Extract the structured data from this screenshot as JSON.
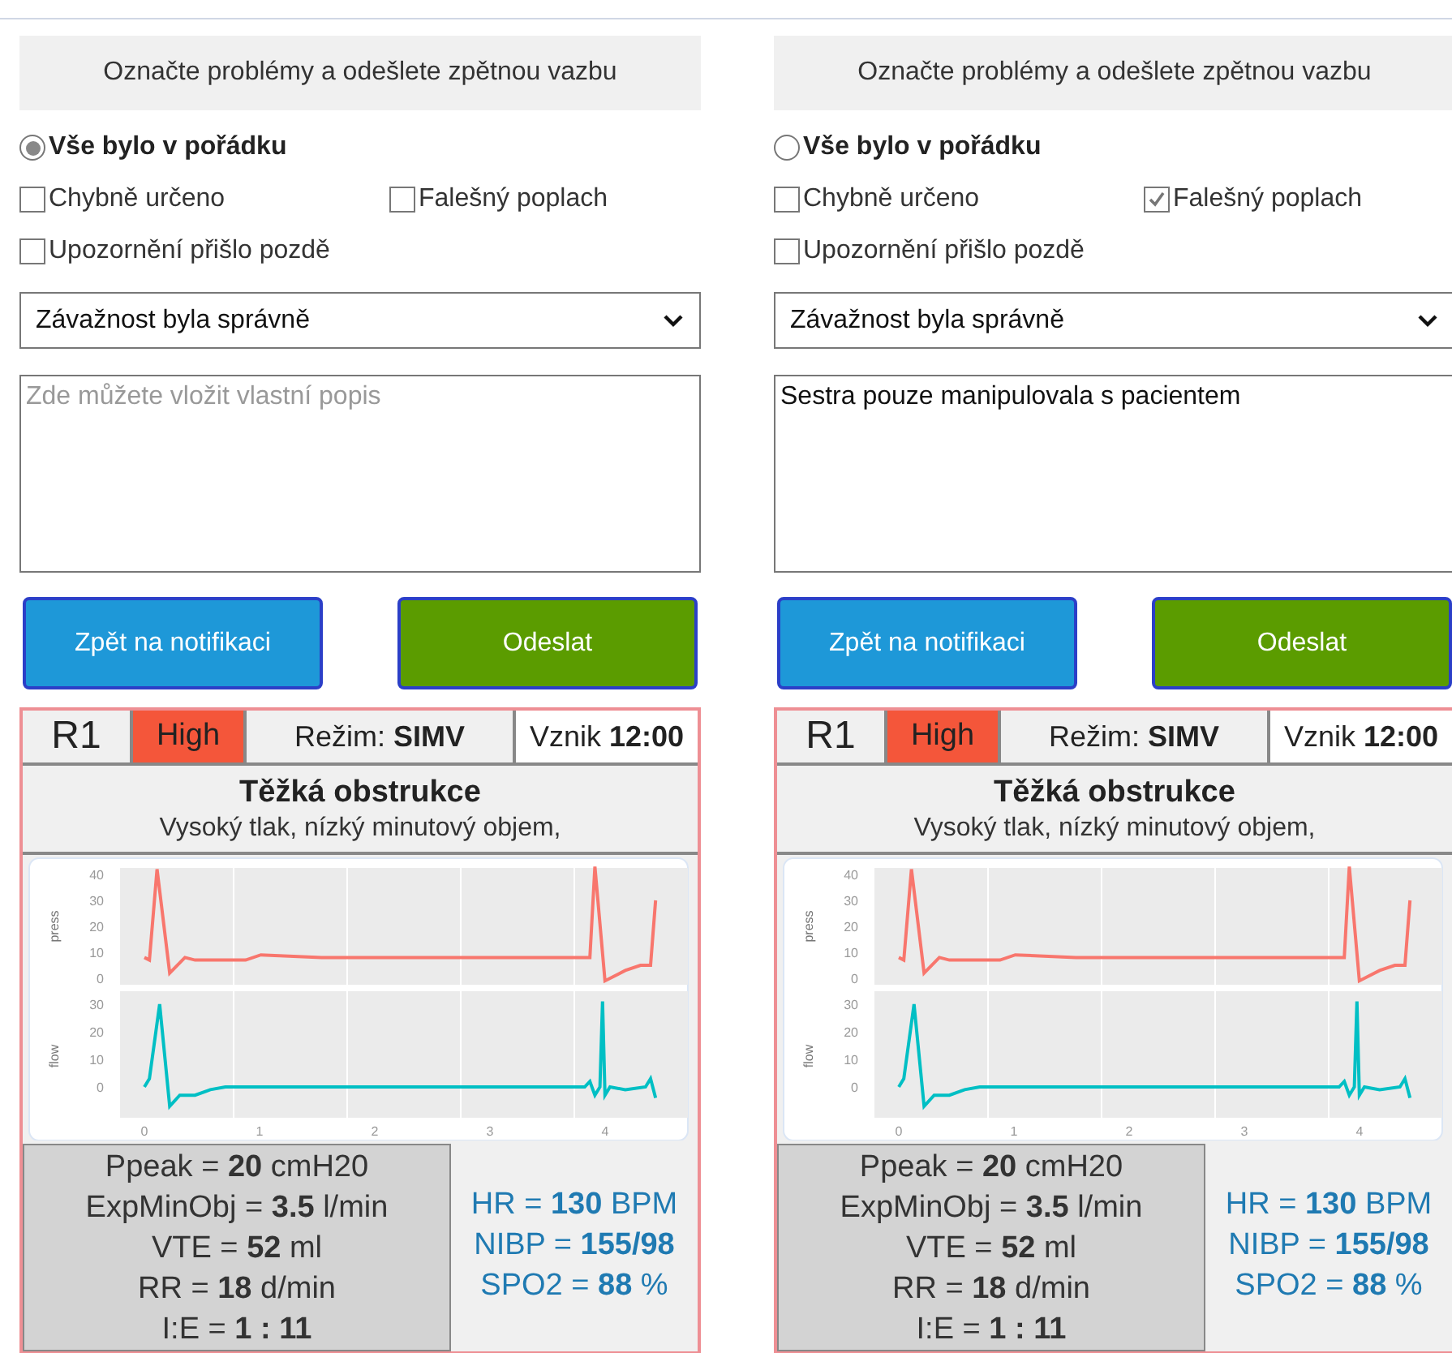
{
  "panels": [
    {
      "header": "Označte problémy a odešlete zpětnou vazbu",
      "radio": {
        "label": "Vše bylo v pořádku",
        "selected": true
      },
      "checkboxes": [
        {
          "label": "Chybně určeno",
          "checked": false
        },
        {
          "label": "Falešný poplach",
          "checked": false
        },
        {
          "label": "Upozornění přišlo pozdě",
          "checked": false
        }
      ],
      "select": "Závažnost byla správně",
      "textarea": {
        "placeholder": "Zde můžete vložit vlastní popis"
      },
      "buttons": [
        {
          "label": "Zpět na notifikaci",
          "kind": "back"
        },
        {
          "label": "Odeslat",
          "kind": "submit"
        }
      ],
      "card": {
        "room": "R1",
        "severity": "High",
        "mode": "Režim: **SIMV**",
        "time": "Vznik **12:00**",
        "title": "Těžká obstrukce",
        "subtitle": "Vysoký tlak, nízký minutový objem,",
        "plot": {
          "top_label": "press",
          "bottom_label": "flow",
          "top_ticks": [
            "40",
            "30",
            "20",
            "10",
            "0"
          ],
          "bottom_ticks": [
            "30",
            "20",
            "10",
            "0"
          ],
          "x_ticks": [
            "0",
            "1",
            "2",
            "3",
            "4"
          ]
        },
        "vent": [
          "Ppeak = **20** cmH20",
          "ExpMinObj = **3.5** l/min",
          "VTE = **52** ml",
          "RR = **18** d/min",
          "I:E = **1 : 11**"
        ],
        "vitals": [
          "HR = **130** BPM",
          "NIBP = **155/98**",
          "SPO2 = **88** %"
        ]
      }
    },
    {
      "header": "Označte problémy a odešlete zpětnou vazbu",
      "radio": {
        "label": "Vše bylo v pořádku",
        "selected": false
      },
      "checkboxes": [
        {
          "label": "Chybně určeno",
          "checked": false
        },
        {
          "label": "Falešný poplach",
          "checked": true
        },
        {
          "label": "Upozornění přišlo pozdě",
          "checked": false
        }
      ],
      "select": "Závažnost byla správně",
      "textarea": {
        "value": "Sestra pouze manipulovala s pacientem"
      },
      "buttons": [
        {
          "label": "Zpět na notifikaci",
          "kind": "back"
        },
        {
          "label": "Odeslat",
          "kind": "submit"
        }
      ],
      "card": {
        "room": "R1",
        "severity": "High",
        "mode": "Režim: **SIMV**",
        "time": "Vznik **12:00**",
        "title": "Těžká obstrukce",
        "subtitle": "Vysoký tlak, nízký minutový objem,",
        "plot": {
          "top_label": "press",
          "bottom_label": "flow",
          "top_ticks": [
            "40",
            "30",
            "20",
            "10",
            "0"
          ],
          "bottom_ticks": [
            "30",
            "20",
            "10",
            "0"
          ],
          "x_ticks": [
            "0",
            "1",
            "2",
            "3",
            "4"
          ]
        },
        "vent": [
          "Ppeak = **20** cmH20",
          "ExpMinObj = **3.5** l/min",
          "VTE = **52** ml",
          "RR = **18** d/min",
          "I:E = **1 : 11**"
        ],
        "vitals": [
          "HR = **130** BPM",
          "NIBP = **155/98**",
          "SPO2 = **88** %"
        ]
      }
    }
  ]
}
